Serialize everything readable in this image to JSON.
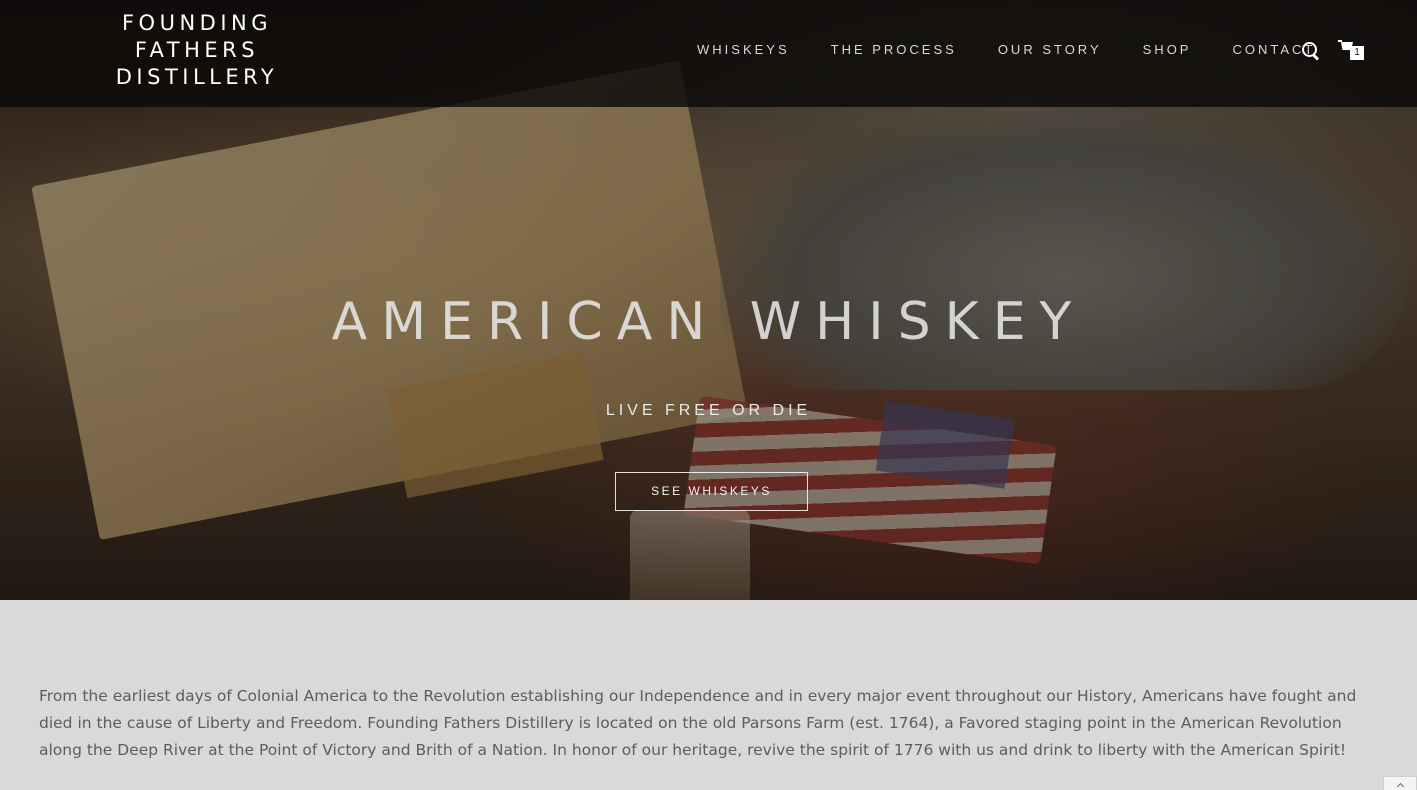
{
  "header": {
    "logo_lines": [
      "FOUNDING",
      "FATHERS",
      "DISTILLERY"
    ],
    "nav": [
      {
        "label": "WHISKEYS"
      },
      {
        "label": "THE PROCESS"
      },
      {
        "label": "OUR STORY"
      },
      {
        "label": "SHOP"
      },
      {
        "label": "CONTACT"
      }
    ],
    "search_icon": "search-icon",
    "cart_icon": "cart-icon",
    "cart_count": "1"
  },
  "hero": {
    "title": "AMERICAN WHISKEY",
    "subtitle": "LIVE FREE OR DIE",
    "button_label": "SEE WHISKEYS"
  },
  "intro": {
    "text": "From the earliest days of Colonial America to the Revolution establishing our Independence and in every major event throughout our History, Americans have fought and died in the cause of Liberty and Freedom. Founding Fathers Distillery is located on the old Parsons Farm (est. 1764), a Favored staging point in the American Revolution along the Deep River at the Point of Victory and Brith of a Nation. In honor of our heritage, revive the spirit of 1776 with us and drink to liberty with the American Spirit!"
  },
  "colors": {
    "topbar": "#0a0908",
    "body_bg": "#d9d9d7",
    "intro_text": "#5d5d5d"
  }
}
